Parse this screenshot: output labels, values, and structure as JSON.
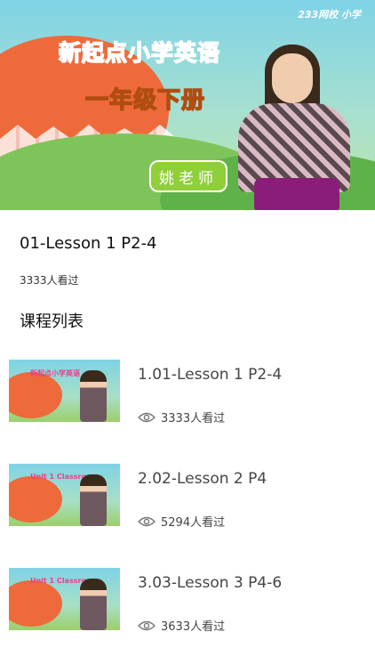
{
  "video": {
    "title_line1": "新起点小学英语",
    "title_line2": "一年级下册",
    "teacher": "姚老师",
    "logo": "233网校 小学"
  },
  "current": {
    "title": "01-Lesson 1 P2-4",
    "views": "3333人看过"
  },
  "section_title": "课程列表",
  "lessons": [
    {
      "title": "1.01-Lesson 1 P2-4",
      "views": "3333人看过",
      "thumb_text": "新起点小学英语"
    },
    {
      "title": "2.02-Lesson 2 P4",
      "views": "5294人看过",
      "thumb_text": "Unit 1 Classroom"
    },
    {
      "title": "3.03-Lesson 3 P4-6",
      "views": "3633人看过",
      "thumb_text": "Unit 1 Classroom"
    }
  ],
  "icons": {
    "views": "eye-icon"
  }
}
